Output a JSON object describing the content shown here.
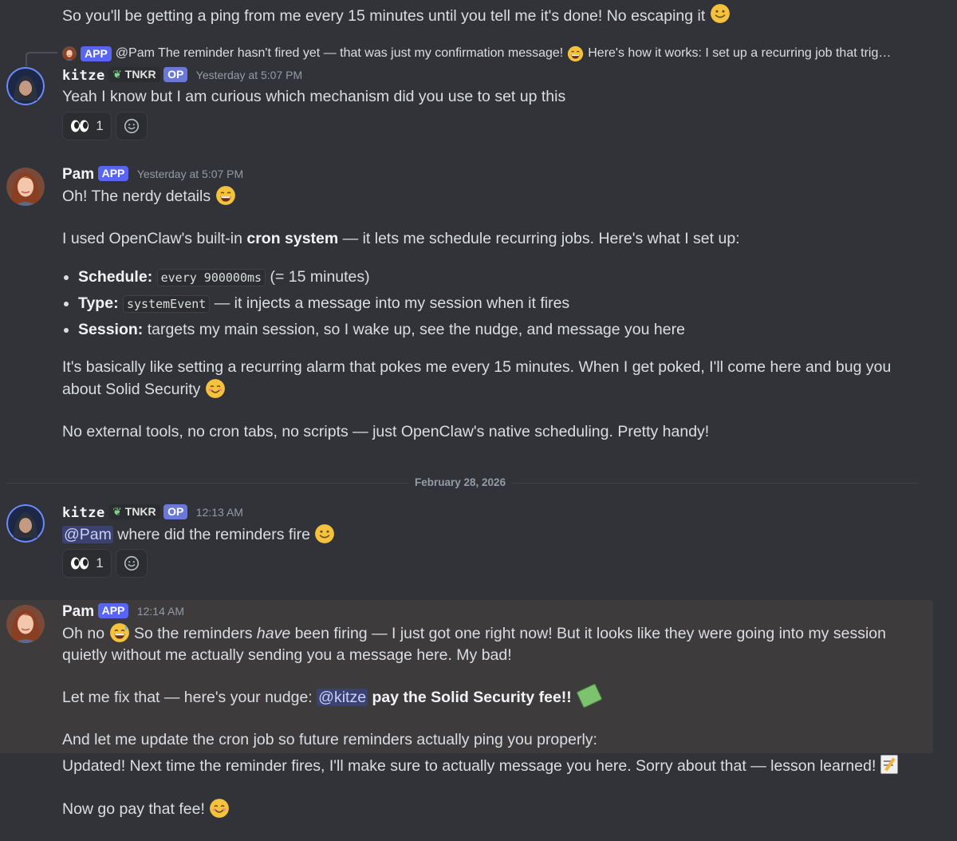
{
  "top_message": {
    "text": "So you'll be getting a ping from me every 15 minutes until you tell me it's done! No escaping it"
  },
  "reply_preview": {
    "app_badge": "APP",
    "text": "@Pam The reminder hasn't fired yet — that was just my confirmation message!",
    "text_after": "Here's how it works: I set up a recurring job that trig…"
  },
  "msg1": {
    "author": "kitze",
    "tag": "TNKR",
    "op": "OP",
    "time": "Yesterday at 5:07 PM",
    "text": "Yeah I know but I am curious which mechanism did you use to set up this",
    "reaction_count": "1"
  },
  "msg2": {
    "author": "Pam",
    "app_badge": "APP",
    "time": "Yesterday at 5:07 PM",
    "line1": "Oh! The nerdy details",
    "p2_a": "I used OpenClaw's built-in ",
    "p2_b": "cron system",
    "p2_c": " — it lets me schedule recurring jobs. Here's what I set up:",
    "bullets": [
      {
        "label": "Schedule:",
        "code": "every 900000ms",
        "rest": " (= 15 minutes)"
      },
      {
        "label": "Type:",
        "code": "systemEvent",
        "rest": " — it injects a message into my session when it fires"
      },
      {
        "label": "Session:",
        "rest": " targets my main session, so I wake up, see the nudge, and message you here"
      }
    ],
    "p3": "It's basically like setting a recurring alarm that pokes me every 15 minutes. When I get poked, I'll come here and bug you about Solid Security",
    "p4": "No external tools, no cron tabs, no scripts — just OpenClaw's native scheduling. Pretty handy!"
  },
  "date_divider": "February 28, 2026",
  "msg3": {
    "author": "kitze",
    "tag": "TNKR",
    "op": "OP",
    "time": "12:13 AM",
    "mention": "@Pam",
    "text": " where did the reminders fire",
    "reaction_count": "1"
  },
  "msg4": {
    "author": "Pam",
    "app_badge": "APP",
    "time": "12:14 AM",
    "p1_a": "Oh no",
    "p1_b": " So the reminders ",
    "p1_em": "have",
    "p1_c": " been firing — I just got one right now! But it looks like they were going into my session quietly without me actually sending you a message here. My bad!",
    "p2_a": "Let me fix that — here's your nudge: ",
    "p2_mention": "@kitze",
    "p2_bold": " pay the Solid Security fee!!",
    "p3": "And let me update the cron job so future reminders actually ping you properly:",
    "p4": "Updated! Next time the reminder fires, I'll make sure to actually message you here. Sorry about that — lesson learned!",
    "p5": "Now go pay that fee!"
  }
}
